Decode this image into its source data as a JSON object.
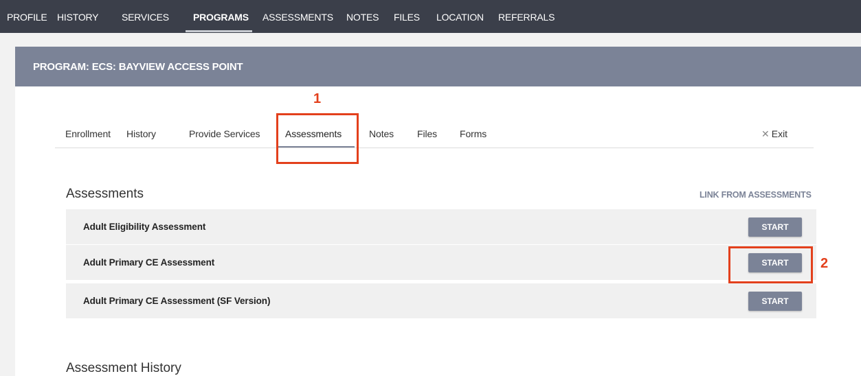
{
  "topnav": {
    "items": [
      {
        "label": "PROFILE"
      },
      {
        "label": "HISTORY"
      },
      {
        "label": "SERVICES"
      },
      {
        "label": "PROGRAMS",
        "active": true
      },
      {
        "label": "ASSESSMENTS"
      },
      {
        "label": "NOTES"
      },
      {
        "label": "FILES"
      },
      {
        "label": "LOCATION"
      },
      {
        "label": "REFERRALS"
      }
    ]
  },
  "program": {
    "title": "PROGRAM: ECS: BAYVIEW ACCESS POINT"
  },
  "subtabs": {
    "items": [
      {
        "label": "Enrollment"
      },
      {
        "label": "History"
      },
      {
        "label": "Provide Services"
      },
      {
        "label": "Assessments",
        "active": true
      },
      {
        "label": "Notes"
      },
      {
        "label": "Files"
      },
      {
        "label": "Forms"
      }
    ],
    "exit_label": "Exit"
  },
  "annotations": {
    "one": "1",
    "two": "2"
  },
  "assessments": {
    "title": "Assessments",
    "link_label": "LINK FROM ASSESSMENTS",
    "rows": [
      {
        "name": "Adult Eligibility Assessment",
        "button": "START"
      },
      {
        "name": "Adult Primary CE Assessment",
        "button": "START"
      },
      {
        "name": "Adult Primary CE Assessment (SF Version)",
        "button": "START"
      }
    ]
  },
  "history": {
    "title": "Assessment History"
  },
  "colors": {
    "topnav_bg": "#3b3f4a",
    "accent": "#7b8397",
    "annotation": "#e3401c"
  }
}
